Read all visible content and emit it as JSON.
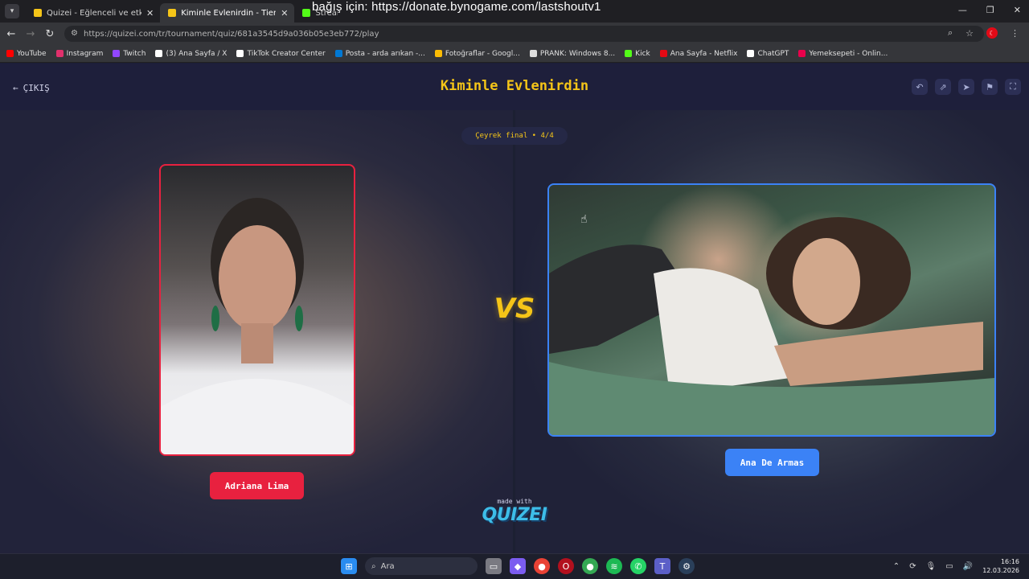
{
  "browser": {
    "tabs": [
      {
        "title": "Quizei - Eğlenceli ve etkileşimli",
        "active": false,
        "favicon_color": "#f5c518"
      },
      {
        "title": "Kiminle Evlenirdin - Tier List, Kı",
        "active": true,
        "favicon_color": "#f5c518"
      },
      {
        "title": "Stream",
        "active": false,
        "favicon_color": "#53fc18"
      }
    ],
    "overlay_text": "bağış için: https://donate.bynogame.com/lastshoutv1",
    "url": "https://quizei.com/tr/tournament/quiz/681a3545d9a036b05e3eb772/play",
    "bookmarks": [
      {
        "label": "YouTube",
        "color": "#ff0000"
      },
      {
        "label": "Instagram",
        "color": "#e1306c"
      },
      {
        "label": "Twitch",
        "color": "#9146ff"
      },
      {
        "label": "(3) Ana Sayfa / X",
        "color": "#ffffff"
      },
      {
        "label": "TikTok Creator Center",
        "color": "#ffffff"
      },
      {
        "label": "Posta - arda arıkan -...",
        "color": "#0078d4"
      },
      {
        "label": "Fotoğraflar - Googl...",
        "color": "#fbbc04"
      },
      {
        "label": "PRANK: Windows 8...",
        "color": "#dddddd"
      },
      {
        "label": "Kick",
        "color": "#53fc18"
      },
      {
        "label": "Ana Sayfa - Netflix",
        "color": "#e50914"
      },
      {
        "label": "ChatGPT",
        "color": "#ffffff"
      },
      {
        "label": "Yemeksepeti - Onlin...",
        "color": "#ea004b"
      }
    ]
  },
  "header": {
    "exit_label": "ÇIKIŞ",
    "title": "Kiminle Evlenirdin",
    "icons": [
      "undo-icon",
      "share-icon",
      "send-icon",
      "flag-icon",
      "fullscreen-icon"
    ]
  },
  "match": {
    "round": "Çeyrek final • 4/4",
    "left": {
      "name": "Adriana Lima",
      "color": "#e8213f"
    },
    "right": {
      "name": "Ana De Armas",
      "color": "#3b82f6"
    },
    "vs": "VS"
  },
  "footer": {
    "made_with": "made with",
    "logo": "QUIZEI"
  },
  "taskbar": {
    "search_placeholder": "Ara",
    "time": "16:16",
    "date": "12.03.2026"
  }
}
